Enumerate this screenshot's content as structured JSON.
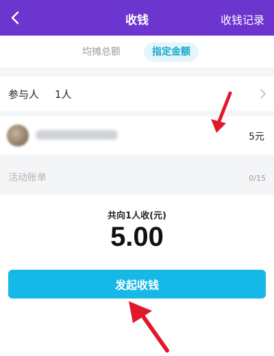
{
  "header": {
    "back_icon": "chevron-left-icon",
    "title": "收钱",
    "right_label": "收钱记录",
    "background": "#6d35cf"
  },
  "tabs": [
    {
      "label": "均摊总额",
      "active": false
    },
    {
      "label": "指定金额",
      "active": true
    }
  ],
  "participants": {
    "label": "参与人",
    "count": "1人",
    "chevron_icon": "chevron-right-icon"
  },
  "member": {
    "amount": "5元"
  },
  "memo": {
    "placeholder": "活动账单",
    "counter": "0/15"
  },
  "summary": {
    "label": "共向1人收(元)",
    "amount": "5.00"
  },
  "submit": {
    "label": "发起收钱",
    "color": "#15b8e6"
  },
  "annotations": {
    "arrow_color": "#e0192a"
  }
}
